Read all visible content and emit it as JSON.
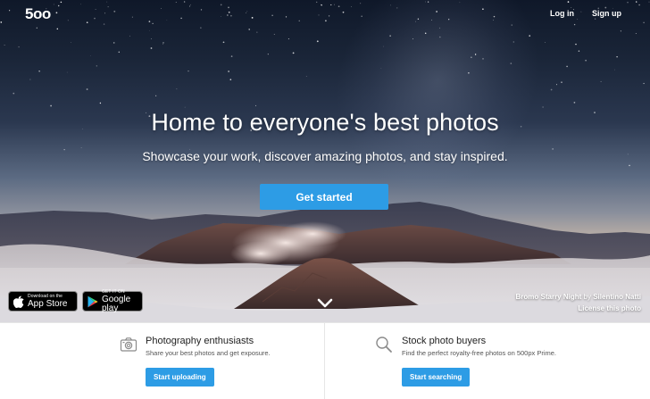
{
  "header": {
    "logo_text": "5oo",
    "login_label": "Log in",
    "signup_label": "Sign up"
  },
  "hero": {
    "headline": "Home to everyone's best photos",
    "subheadline": "Showcase your work, discover amazing photos, and stay inspired.",
    "cta_label": "Get started",
    "photo_title": "Bromo Starry Night",
    "photo_by": "by",
    "photographer": "Silentino Natti",
    "license_label": "License this photo"
  },
  "app_badges": {
    "apple": {
      "small": "Download on the",
      "big": "App Store",
      "icon": "apple-icon"
    },
    "google": {
      "small": "GET IT ON",
      "big": "Google play",
      "icon": "google-play-icon"
    }
  },
  "panels": {
    "enthusiasts": {
      "icon": "camera-icon",
      "title": "Photography enthusiasts",
      "description": "Share your best photos and get exposure.",
      "button_label": "Start uploading"
    },
    "buyers": {
      "icon": "search-icon",
      "title": "Stock photo buyers",
      "description": "Find the perfect royalty-free photos on 500px Prime.",
      "button_label": "Start searching"
    }
  },
  "colors": {
    "accent": "#2d9ce5",
    "sky_top": "#0f1829",
    "cloud": "#d7d5d9"
  }
}
